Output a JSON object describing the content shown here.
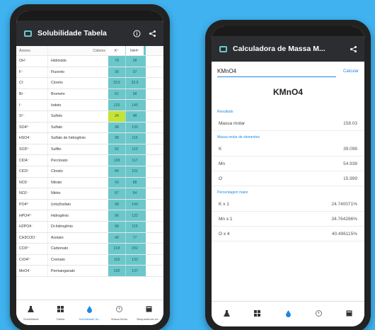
{
  "solubility": {
    "title": "Solubilidade Tabela",
    "columns": {
      "ion": "Ânions",
      "cation": "Cátions",
      "k": "K⁺",
      "nh4": "NH4⁺"
    },
    "rows": [
      {
        "ion": "OH⁻",
        "name": "Hidróxido",
        "k": "78",
        "nh4": "28"
      },
      {
        "ion": "F⁻",
        "name": "Fluoreto",
        "k": "30",
        "nh4": "37"
      },
      {
        "ion": "Cl⁻",
        "name": "Cloreto",
        "k": "33.5",
        "nh4": "33.5"
      },
      {
        "ion": "Br⁻",
        "name": "Brometo",
        "k": "61",
        "nh4": "58"
      },
      {
        "ion": "I⁻",
        "name": "Iodeto",
        "k": "126",
        "nh4": "145"
      },
      {
        "ion": "S²⁻",
        "name": "Sulfeto",
        "k": "24",
        "nh4": "48"
      },
      {
        "ion": "SO4²⁻",
        "name": "Sulfato",
        "k": "98",
        "nh4": "130"
      },
      {
        "ion": "HSO4⁻",
        "name": "Sulfato de hidrogênio",
        "k": "98",
        "nh4": "115"
      },
      {
        "ion": "SO3²⁻",
        "name": "Sulfito",
        "k": "92",
        "nh4": "110"
      },
      {
        "ion": "ClO4⁻",
        "name": "Perclorato",
        "k": "138",
        "nh4": "117"
      },
      {
        "ion": "ClO3⁻",
        "name": "Clorato",
        "k": "84",
        "nh4": "101"
      },
      {
        "ion": "NO3⁻",
        "name": "Nitrato",
        "k": "43",
        "nh4": "88"
      },
      {
        "ion": "NO2⁻",
        "name": "Nitrito",
        "k": "87",
        "nh4": "64"
      },
      {
        "ion": "PO4³⁻",
        "name": "(orto)fosfato",
        "k": "98",
        "nh4": "149"
      },
      {
        "ion": "HPO4²⁻",
        "name": "Hidrogênio",
        "k": "96",
        "nh4": "132"
      },
      {
        "ion": "H2PO4⁻",
        "name": "Di-hidrogênio",
        "k": "98",
        "nh4": "115"
      },
      {
        "ion": "CH3COO⁻",
        "name": "Acetato",
        "k": "40",
        "nh4": "77"
      },
      {
        "ion": "CO3²⁻",
        "name": "Carbonato",
        "k": "218",
        "nh4": "292"
      },
      {
        "ion": "CrO4²⁻",
        "name": "Cromato",
        "k": "118",
        "nh4": "132"
      },
      {
        "ion": "MnO4⁻",
        "name": "Permanganato",
        "k": "130",
        "nh4": "137"
      }
    ],
    "highlight_row": 5,
    "accent_color": "#6cc7cb",
    "highlight_color": "#c3e23a"
  },
  "nav": [
    {
      "label": "Solubilidade",
      "icon": "flask-icon"
    },
    {
      "label": "Tabela",
      "icon": "grid-icon"
    },
    {
      "label": "Solubilidade de...",
      "icon": "drop-icon"
    },
    {
      "label": "Massa Molar",
      "icon": "scale-icon"
    },
    {
      "label": "Bloqueadores de...",
      "icon": "book-icon"
    }
  ],
  "calculator": {
    "title": "Calculadora de Massa M...",
    "input_value": "KMnO4",
    "calc_label": "Calcular",
    "formula": "KMnO4",
    "result_label": "Resultado",
    "molar_label": "Massa molar",
    "molar_value": "158.03",
    "elements_label": "Massa molar de elementos",
    "elements": [
      {
        "el": "K",
        "value": "39.098"
      },
      {
        "el": "Mn",
        "value": "54.938"
      },
      {
        "el": "O",
        "value": "15.999"
      }
    ],
    "percent_label": "Percentagem maior",
    "percents": [
      {
        "el": "K x 1",
        "value": "24.740071%"
      },
      {
        "el": "Mn x 1",
        "value": "34.764286%"
      },
      {
        "el": "O x 4",
        "value": "40.496115%"
      }
    ]
  }
}
